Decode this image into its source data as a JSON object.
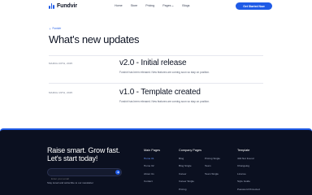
{
  "nav": {
    "brand": "Fundvir",
    "links": [
      "Home",
      "Store",
      "Pricing",
      "Pages",
      "Blogs"
    ],
    "cta": "Get Started Now"
  },
  "breadcrumb": "Fundvir",
  "page_title": "What's new updates",
  "entries": [
    {
      "date": "MARCH 20TH, 2025",
      "title": "v2.0 - Initial release",
      "desc": "Fundvir has been released. New features are coming soon so stay on position."
    },
    {
      "date": "MARCH 19TH, 2025",
      "title": "v1.0 - Template created",
      "desc": "Fundvir has been released. New features are coming soon so stay on position."
    }
  ],
  "footer": {
    "headline_1": "Raise smart. Grow fast.",
    "headline_2": "Let's start today!",
    "email_placeholder": "Enter your email",
    "note": "Stay tuned and subscribe to our newsletter",
    "main_pages": {
      "title": "Main Pages",
      "links": [
        "Home 01",
        "Home 02",
        "About Us",
        "Contact"
      ]
    },
    "company_pages": {
      "title": "Company Pages",
      "col1": [
        "Blog",
        "Blog Single",
        "Career",
        "Career Single",
        "Pricing"
      ],
      "col2": [
        "Pricing Single",
        "Team",
        "Team Single"
      ]
    },
    "template": {
      "title": "Template",
      "links": [
        "404 Not Found",
        "Changelog",
        "License",
        "Style Guide",
        "Password Protected"
      ]
    }
  },
  "colors": {
    "accent": "#1f5be6",
    "footer_bg": "#0b1020"
  }
}
